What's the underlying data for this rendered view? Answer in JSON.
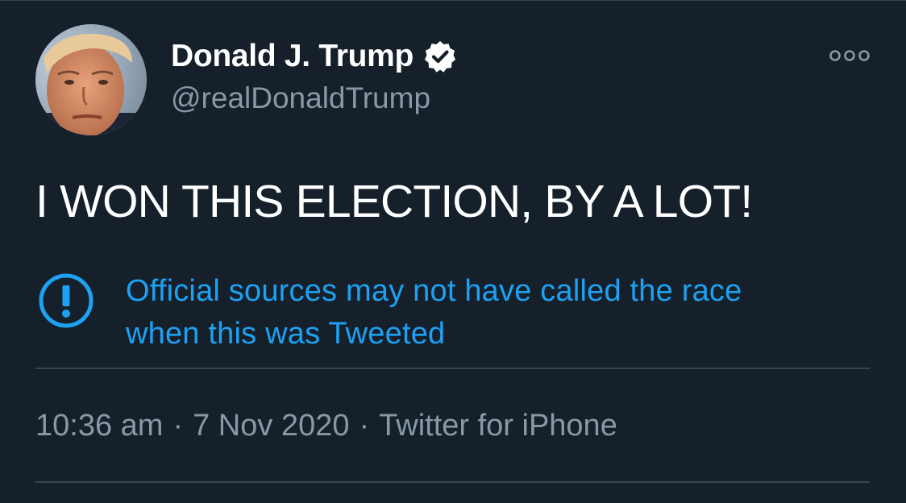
{
  "author": {
    "display_name": "Donald J. Trump",
    "handle": "@realDonaldTrump",
    "verified": true,
    "avatar_icon": "user-avatar"
  },
  "tweet": {
    "text": "I WON THIS ELECTION, BY A LOT!"
  },
  "notice": {
    "icon": "exclamation-circle-icon",
    "line1": "Official sources may not have called the race",
    "line2": "when this was Tweeted"
  },
  "meta": {
    "time": "10:36 am",
    "separator": "·",
    "date": "7 Nov 2020",
    "source": "Twitter for iPhone"
  },
  "menu": {
    "icon": "more-options-icon"
  },
  "colors": {
    "background": "#15202b",
    "text_primary": "#ffffff",
    "text_secondary": "#8899a6",
    "accent": "#1da1f2",
    "divider": "#38444d"
  }
}
